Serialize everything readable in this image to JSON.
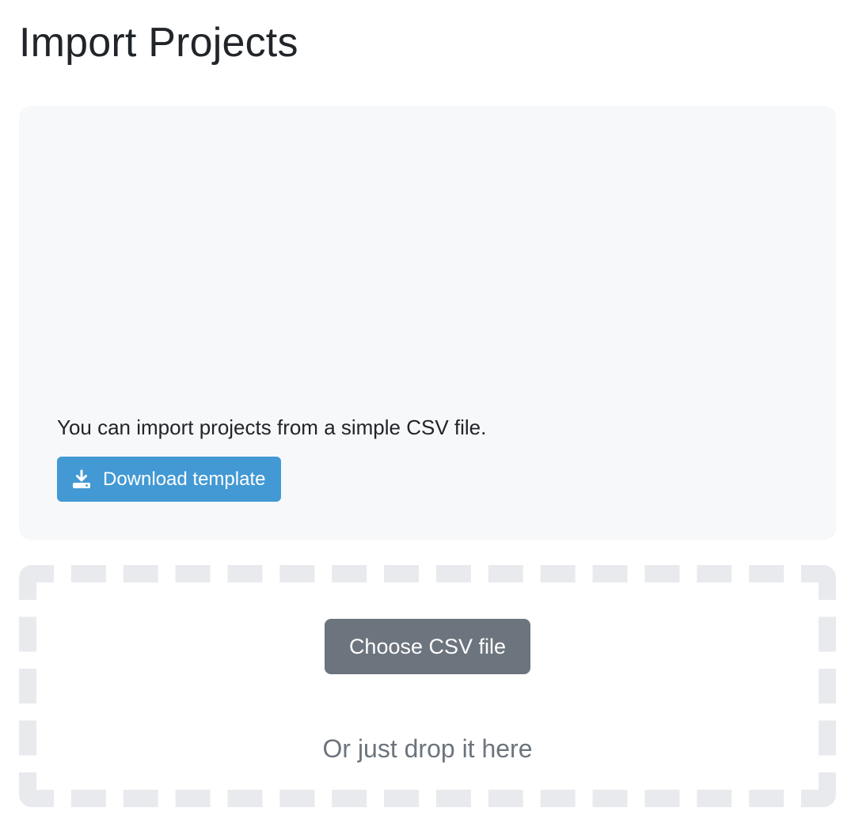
{
  "page": {
    "title": "Import Projects"
  },
  "info_panel": {
    "text": "You can import projects from a simple CSV file.",
    "download_button": {
      "label": "Download template",
      "icon": "download-icon"
    }
  },
  "drop_zone": {
    "choose_button_label": "Choose CSV file",
    "hint": "Or just drop it here"
  },
  "colors": {
    "primary_button": "#4299d4",
    "secondary_button": "#6c747d",
    "panel_background": "#f7f8fa",
    "dashed_border": "#e9eaee",
    "text": "#212529",
    "muted_text": "#6c747d"
  }
}
